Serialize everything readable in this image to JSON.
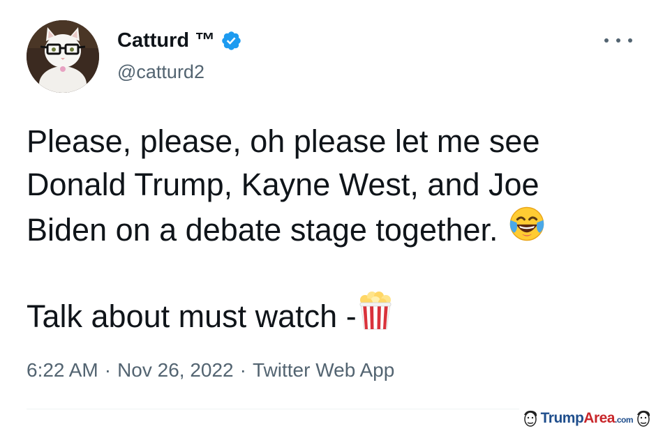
{
  "author": {
    "display_name": "Catturd ™",
    "handle": "@catturd2",
    "avatar_icon": "cat-with-glasses-avatar",
    "verified": true,
    "verified_color": "#1d9bf0"
  },
  "tweet": {
    "lines": [
      "Please, please, oh please let me see",
      "Donald Trump, Kayne West, and Joe",
      "Biden on a debate stage together."
    ],
    "line_last": "Talk about must watch -",
    "emojis": [
      "face-with-tears-of-joy-icon",
      "popcorn-icon"
    ]
  },
  "meta": {
    "time": "6:22 AM",
    "date": "Nov 26, 2022",
    "separator": "·",
    "source": "Twitter Web App"
  },
  "more_icon": "more-options-icon",
  "watermark": {
    "brand_part1": "Trump",
    "brand_part2": "Area",
    "brand_suffix": ".com",
    "brand_color_blue": "#1f4e8c",
    "brand_color_red": "#c8262a"
  },
  "colors": {
    "text_primary": "#0f1419",
    "text_secondary": "#536471",
    "background": "#ffffff"
  }
}
